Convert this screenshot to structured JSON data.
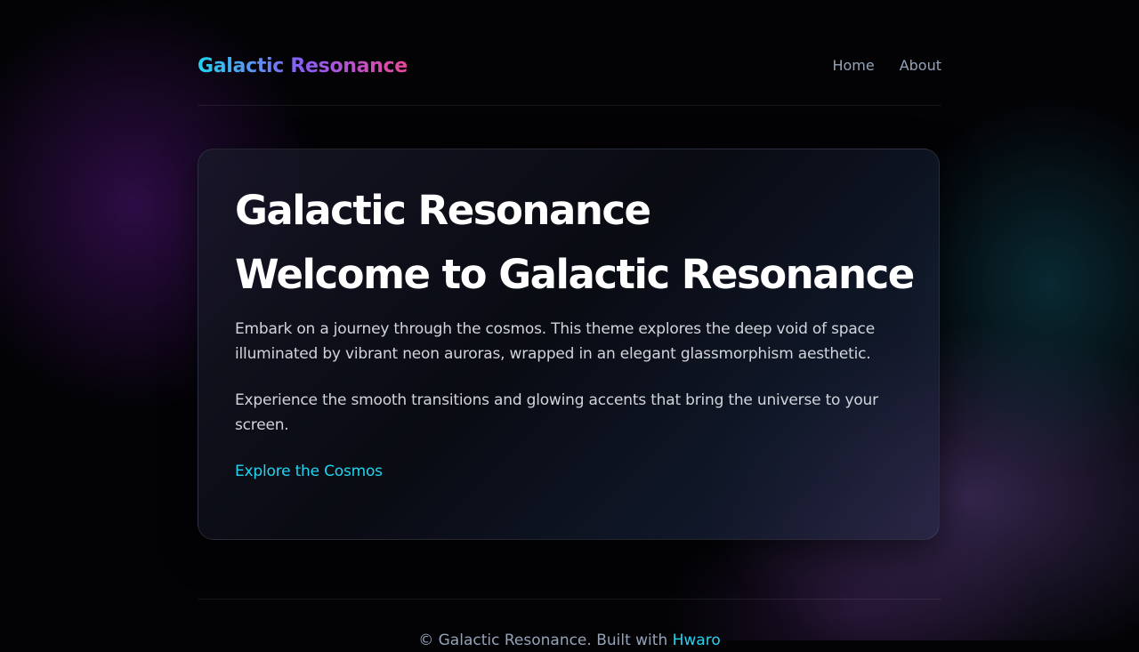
{
  "header": {
    "brand": "Galactic Resonance",
    "nav": [
      {
        "label": "Home"
      },
      {
        "label": "About"
      }
    ]
  },
  "card": {
    "title": "Galactic Resonance",
    "heading": "Welcome to Galactic Resonance",
    "paragraphs": [
      "Embark on a journey through the cosmos. This theme explores the deep void of space illuminated by vibrant neon auroras, wrapped in an elegant glassmorphism aesthetic.",
      "Experience the smooth transitions and glowing accents that bring the universe to your screen."
    ],
    "cta": "Explore the Cosmos"
  },
  "footer": {
    "text": "© Galactic Resonance. Built with ",
    "link": "Hwaro"
  },
  "colors": {
    "background": "#030306",
    "accent_cyan": "#22d3ee",
    "accent_violet": "#8b5cf6",
    "accent_pink": "#ec4899",
    "muted_text": "#94a3b8"
  }
}
